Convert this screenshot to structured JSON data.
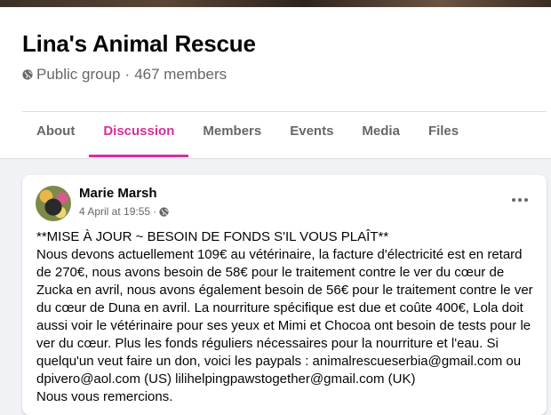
{
  "group": {
    "name": "Lina's Animal Rescue",
    "privacy": "Public group",
    "separator": "·",
    "members": "467 members"
  },
  "tabs": [
    {
      "label": "About"
    },
    {
      "label": "Discussion"
    },
    {
      "label": "Members"
    },
    {
      "label": "Events"
    },
    {
      "label": "Media"
    },
    {
      "label": "Files"
    }
  ],
  "active_tab": "Discussion",
  "colors": {
    "accent": "#d62f9c",
    "text_secondary": "#65676b"
  },
  "post": {
    "author": "Marie Marsh",
    "timestamp": "4 April at 19:55",
    "separator": "·",
    "audience_icon": "globe-icon",
    "body": [
      "**MISE À JOUR ~ BESOIN DE FONDS S'IL VOUS PLAÎT**",
      "Nous devons actuellement 109€ au vétérinaire, la facture d'électricité est en retard de 270€, nous avons besoin de 58€ pour le traitement contre le ver du cœur de Zucka en avril, nous avons également besoin de 56€ pour le traitement contre le ver du cœur de Duna en avril. La nourriture spécifique est due et coûte 400€, Lola doit aussi voir le vétérinaire pour ses yeux et Mimi et Chocoa ont besoin de tests pour le ver du cœur. Plus les fonds réguliers nécessaires pour la nourriture et l'eau. Si quelqu'un veut faire un don, voici les paypals : animalrescueserbia@gmail.com ou dpivero@aol.com (US) lilihelpingpawstogether@gmail.com (UK)",
      "Nous vous remercions."
    ]
  }
}
